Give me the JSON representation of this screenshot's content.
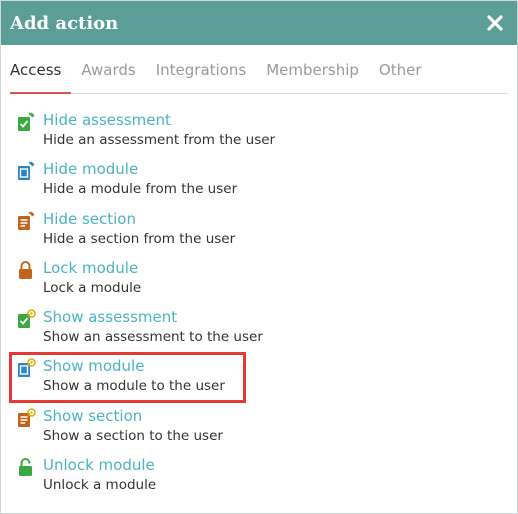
{
  "dialog": {
    "title": "Add action",
    "close_icon": "close-icon"
  },
  "tabs": [
    {
      "label": "Access",
      "active": true
    },
    {
      "label": "Awards",
      "active": false
    },
    {
      "label": "Integrations",
      "active": false
    },
    {
      "label": "Membership",
      "active": false
    },
    {
      "label": "Other",
      "active": false
    }
  ],
  "actions": [
    {
      "title": "Hide assessment",
      "description": "Hide an assessment from the user",
      "icon": "hide-assessment-icon",
      "color": "#3aa843"
    },
    {
      "title": "Hide module",
      "description": "Hide a module from the user",
      "icon": "hide-module-icon",
      "color": "#2e86c1"
    },
    {
      "title": "Hide section",
      "description": "Hide a section from the user",
      "icon": "hide-section-icon",
      "color": "#c0651e"
    },
    {
      "title": "Lock module",
      "description": "Lock a module",
      "icon": "lock-icon",
      "color": "#c0651e"
    },
    {
      "title": "Show assessment",
      "description": "Show an assessment to the user",
      "icon": "show-assessment-icon",
      "color": "#3aa843"
    },
    {
      "title": "Show module",
      "description": "Show a module to the user",
      "icon": "show-module-icon",
      "color": "#2e86c1",
      "highlighted": true
    },
    {
      "title": "Show section",
      "description": "Show a section to the user",
      "icon": "show-section-icon",
      "color": "#c0651e"
    },
    {
      "title": "Unlock module",
      "description": "Unlock a module",
      "icon": "unlock-icon",
      "color": "#3aa843"
    }
  ],
  "colors": {
    "header": "#5b9e97",
    "link": "#4bb3c4",
    "active_tab_underline": "#d9534f",
    "highlight": "#e53935"
  }
}
